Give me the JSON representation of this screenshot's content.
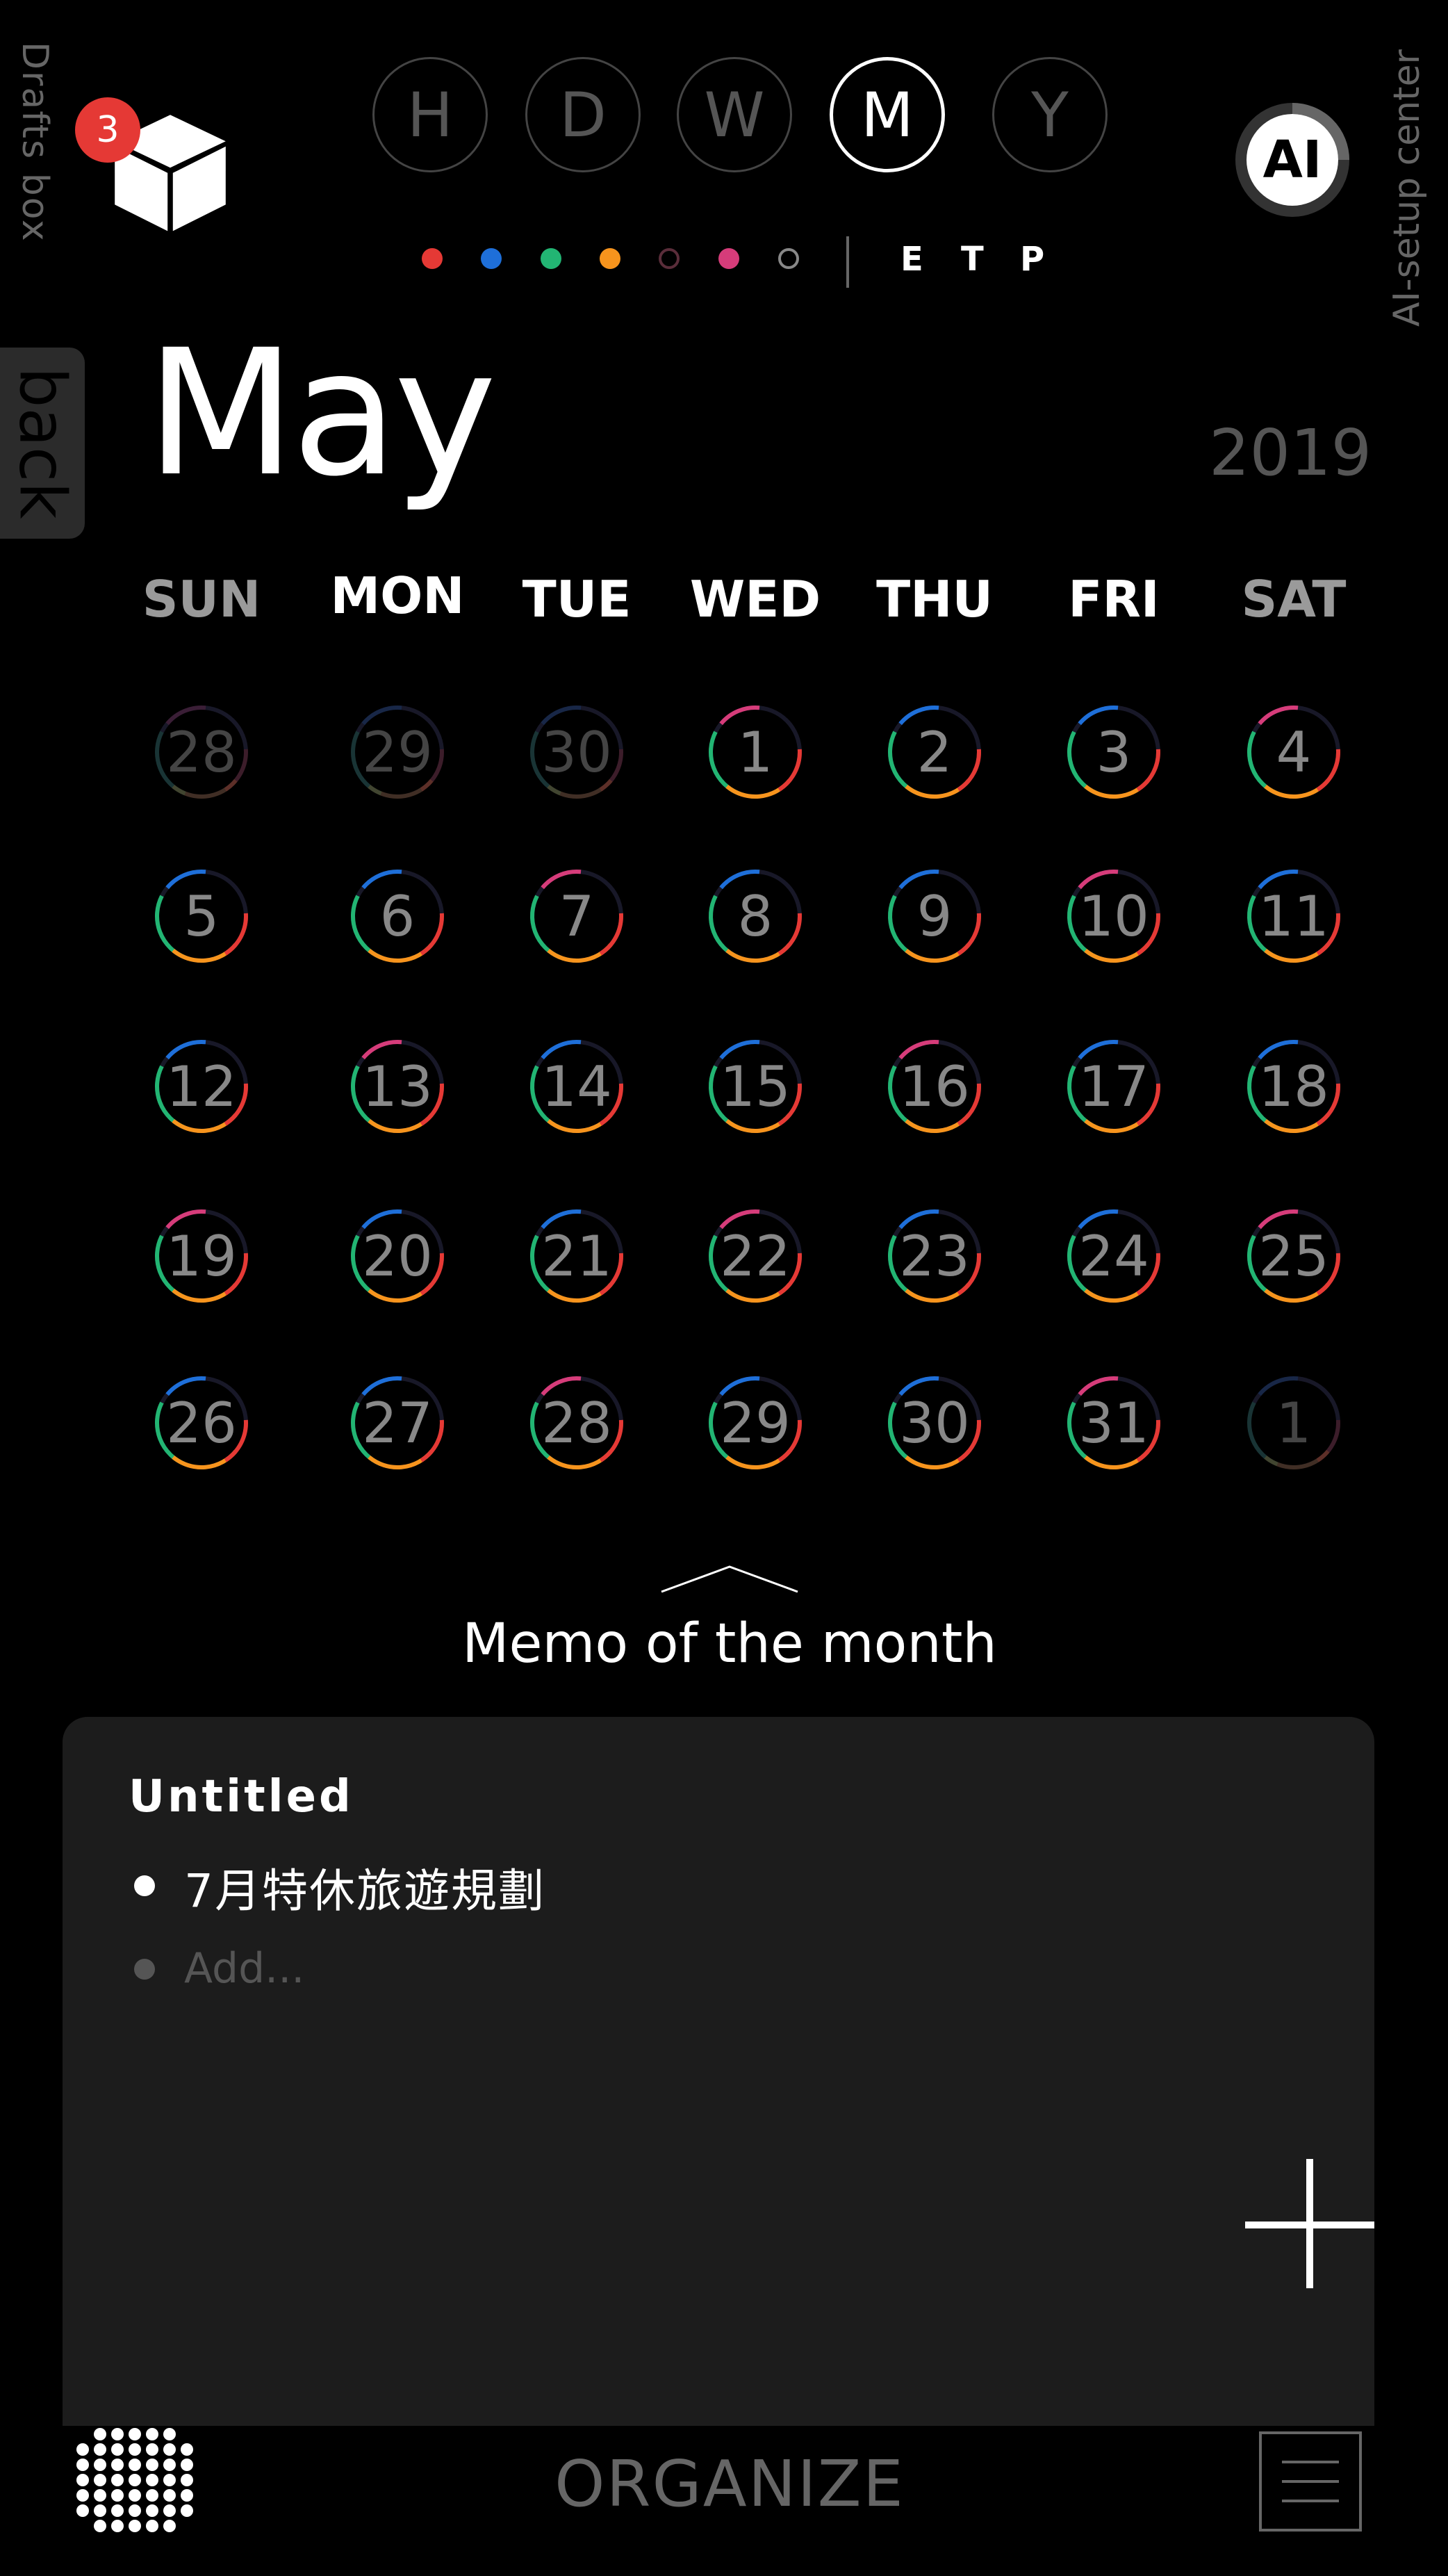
{
  "drafts": {
    "label": "Drafts box",
    "badge": "3"
  },
  "modes": [
    {
      "label": "H",
      "active": false
    },
    {
      "label": "D",
      "active": false
    },
    {
      "label": "W",
      "active": false
    },
    {
      "label": "M",
      "active": true
    },
    {
      "label": "Y",
      "active": false
    }
  ],
  "ai": {
    "button_label": "AI",
    "side_label": "AI-setup center"
  },
  "category_colors": [
    "#e53935",
    "#1e6fd9",
    "#22b573",
    "#f7941d",
    "#5a2d3a",
    "#d63c7a",
    "#888888"
  ],
  "filters": [
    "E",
    "T",
    "P"
  ],
  "back_label": "back",
  "calendar": {
    "month": "May",
    "year": "2019",
    "weekdays": [
      "SUN",
      "MON",
      "TUE",
      "WED",
      "THU",
      "FRI",
      "SAT"
    ],
    "weekday_colors": [
      "#9a9a9a",
      "#ffffff",
      "#ffffff",
      "#ffffff",
      "#ffffff",
      "#ffffff",
      "#9a9a9a"
    ],
    "weeks": [
      [
        {
          "d": "28",
          "dim": true
        },
        {
          "d": "29",
          "dim": true
        },
        {
          "d": "30",
          "dim": true
        },
        {
          "d": "1"
        },
        {
          "d": "2"
        },
        {
          "d": "3"
        },
        {
          "d": "4"
        }
      ],
      [
        {
          "d": "5"
        },
        {
          "d": "6"
        },
        {
          "d": "7"
        },
        {
          "d": "8"
        },
        {
          "d": "9"
        },
        {
          "d": "10"
        },
        {
          "d": "11"
        }
      ],
      [
        {
          "d": "12"
        },
        {
          "d": "13"
        },
        {
          "d": "14"
        },
        {
          "d": "15"
        },
        {
          "d": "16"
        },
        {
          "d": "17"
        },
        {
          "d": "18"
        }
      ],
      [
        {
          "d": "19"
        },
        {
          "d": "20"
        },
        {
          "d": "21"
        },
        {
          "d": "22"
        },
        {
          "d": "23"
        },
        {
          "d": "24"
        },
        {
          "d": "25"
        }
      ],
      [
        {
          "d": "26"
        },
        {
          "d": "27"
        },
        {
          "d": "28"
        },
        {
          "d": "29"
        },
        {
          "d": "30"
        },
        {
          "d": "31"
        },
        {
          "d": "1",
          "dim": true
        }
      ]
    ]
  },
  "memo": {
    "section_title": "Memo of the month",
    "card_title": "Untitled",
    "items": [
      "7月特休旅遊規劃"
    ],
    "add_placeholder": "Add..."
  },
  "bottom_bar": {
    "organize_label": "ORGANIZE"
  },
  "icons": {
    "cube": "cube-icon",
    "plus": "plus-icon",
    "grid": "dot-grid-icon",
    "menu": "menu-icon",
    "chevron": "chevron-up-icon"
  }
}
